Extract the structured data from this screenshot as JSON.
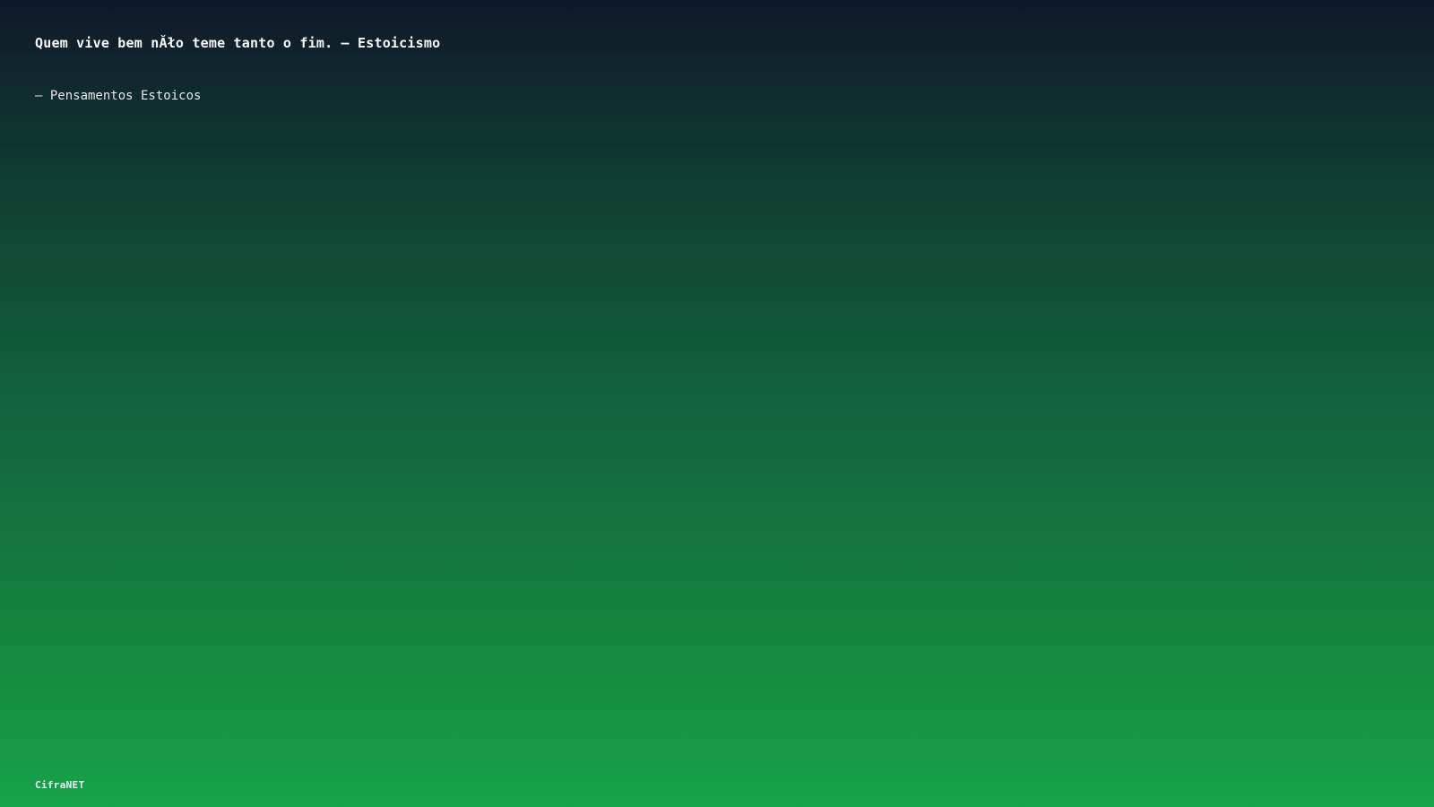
{
  "quote": {
    "text": "Quem vive bem nĂło teme tanto o fim. — Estoicismo",
    "source": "— Pensamentos Estoicos"
  },
  "footer": {
    "brand": "CifraNET"
  },
  "colors": {
    "gradient_top": "#0f172a",
    "gradient_bottom": "#16a34a",
    "text": "#ffffff"
  }
}
